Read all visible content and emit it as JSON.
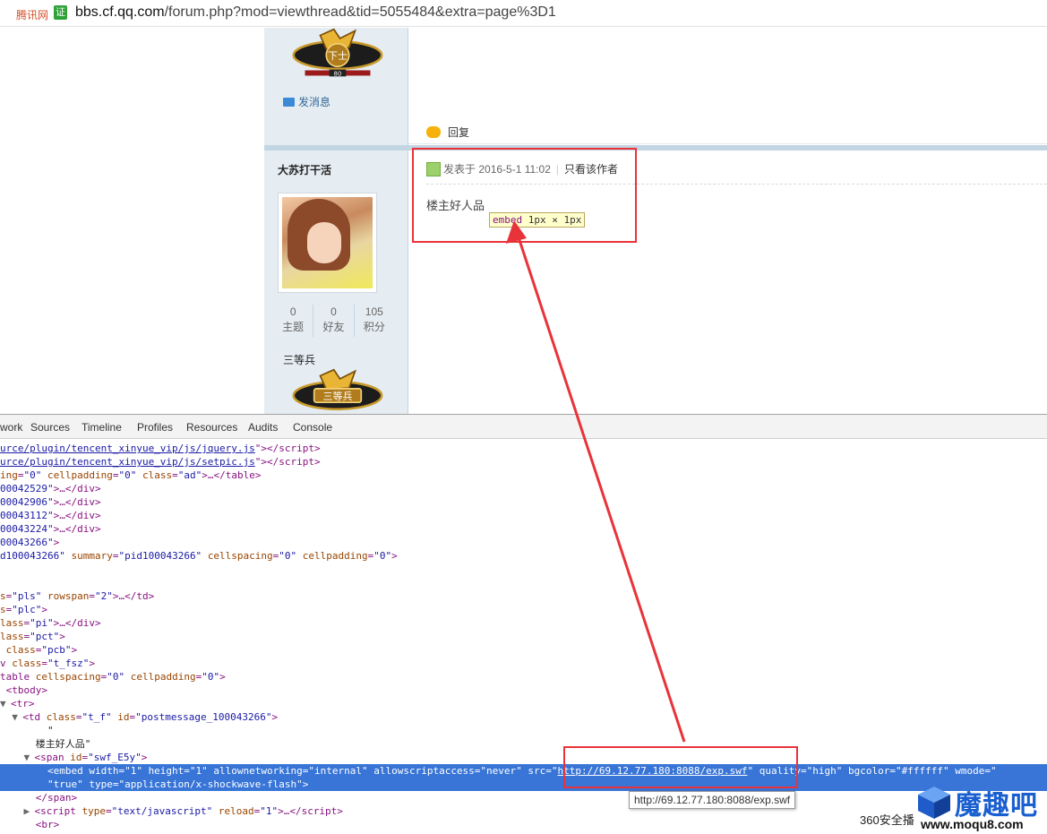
{
  "address_bar": {
    "site_name": "腾讯网",
    "cert_label": "证",
    "url_host": "bbs.cf.qq.com",
    "url_path": "/forum.php?mod=viewthread&tid=5055484&extra=page%3D1"
  },
  "post_prev": {
    "rank_badge_text": "下士",
    "rank_level": "80",
    "send_message": "发消息",
    "reply": "回复"
  },
  "post": {
    "author": "大苏打干活",
    "stats": [
      {
        "value": "0",
        "label": "主题"
      },
      {
        "value": "0",
        "label": "好友"
      },
      {
        "value": "105",
        "label": "积分"
      }
    ],
    "rank_name": "三等兵",
    "rank_badge_text": "三等兵",
    "posted_prefix": "发表于",
    "posted_time": "2016-5-1 11:02",
    "only_author": "只看该作者",
    "content": "楼主好人品",
    "inspect_tooltip": {
      "tag": "embed",
      "size": "1px × 1px"
    }
  },
  "devtools": {
    "tabs": [
      "work",
      "Sources",
      "Timeline",
      "Profiles",
      "Resources",
      "Audits",
      "Console"
    ],
    "url_tooltip": "http://69.12.77.180:8088/exp.swf"
  },
  "watermark": {
    "brand": "魔趣吧",
    "site": "www.moqu8.com",
    "small": "360安全播",
    "sub": "MOQU8.COM"
  },
  "colors": {
    "highlight_red": "#e8333a",
    "selection_blue": "#3875d7",
    "sidebar_bg": "#e5edf2"
  }
}
